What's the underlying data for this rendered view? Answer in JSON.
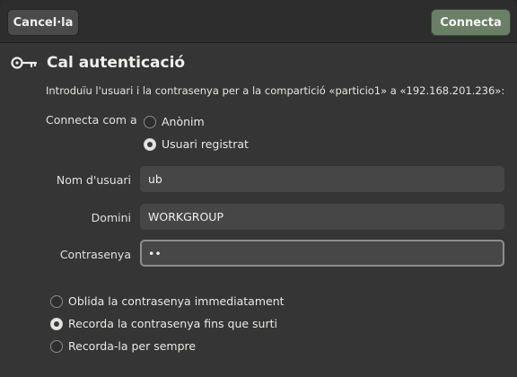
{
  "background": {
    "window_fragment": "particio1"
  },
  "header": {
    "cancel_label": "Cancel·la",
    "connect_label": "Connecta"
  },
  "title": "Cal autenticació",
  "description": "Introduïu l'usuari i la contrasenya per a la compartició «particio1» a «192.168.201.236»:",
  "connect_as": {
    "label": "Connecta com a",
    "options": [
      {
        "label": "Anònim",
        "checked": false
      },
      {
        "label": "Usuari registrat",
        "checked": true
      }
    ]
  },
  "fields": {
    "username": {
      "label": "Nom d'usuari",
      "value": "ub"
    },
    "domain": {
      "label": "Domini",
      "value": "WORKGROUP"
    },
    "password": {
      "label": "Contrasenya",
      "value": "••"
    }
  },
  "remember": {
    "options": [
      {
        "label": "Oblida la contrasenya immediatament",
        "checked": false
      },
      {
        "label": "Recorda la contrasenya fins que surti",
        "checked": true
      },
      {
        "label": "Recorda-la per sempre",
        "checked": false
      }
    ]
  },
  "colors": {
    "accent_button": "#6a8066",
    "dialog_bg": "#353535",
    "header_bg": "#2d2d2d",
    "entry_bg": "#464646"
  },
  "icons": {
    "title_icon": "key-icon"
  }
}
